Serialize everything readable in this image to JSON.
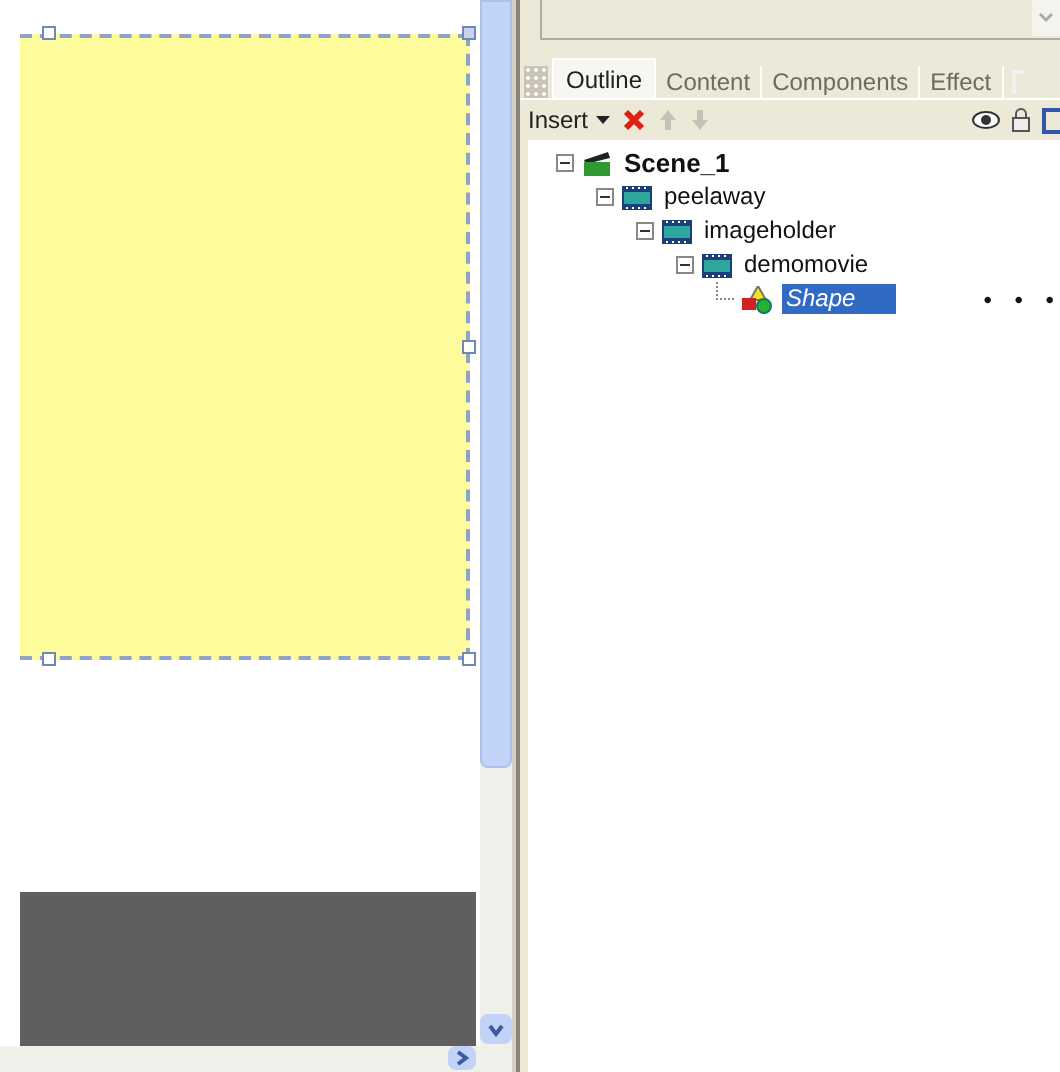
{
  "tabs": [
    {
      "label": "Outline",
      "selected": true
    },
    {
      "label": "Content",
      "selected": false
    },
    {
      "label": "Components",
      "selected": false
    },
    {
      "label": "Effect",
      "selected": false
    }
  ],
  "toolbar": {
    "insert_label": "Insert",
    "delete_disabled": false,
    "move_up_disabled": true,
    "move_down_disabled": true
  },
  "outline": [
    {
      "label": "Scene_1",
      "kind": "scene",
      "expanded": true,
      "selected": false,
      "children": [
        {
          "label": "peelaway",
          "kind": "movieclip",
          "expanded": true,
          "selected": false,
          "children": [
            {
              "label": "imageholder",
              "kind": "movieclip",
              "expanded": true,
              "selected": false,
              "children": [
                {
                  "label": "demomovie",
                  "kind": "movieclip",
                  "expanded": true,
                  "selected": false,
                  "children": [
                    {
                      "label": "Shape",
                      "kind": "shape",
                      "selected": true,
                      "trailing": "• • •"
                    }
                  ]
                }
              ]
            }
          ]
        }
      ]
    }
  ]
}
